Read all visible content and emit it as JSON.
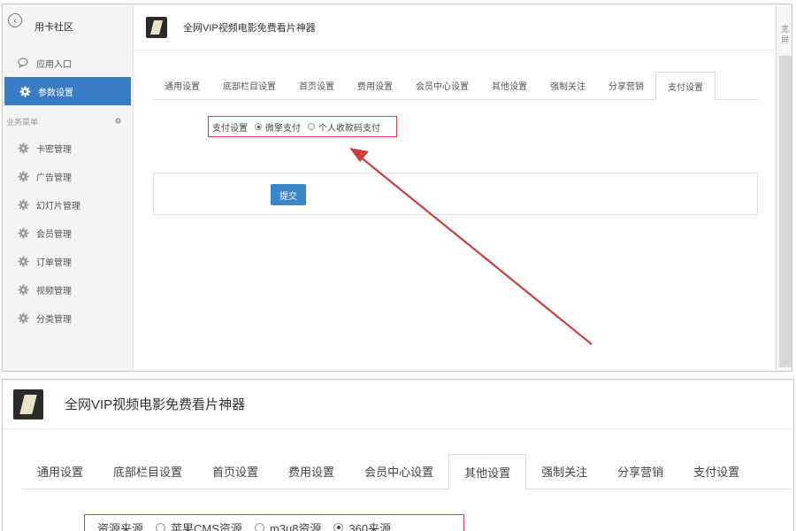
{
  "top": {
    "sidebar": {
      "brand": "用卡社区",
      "items_main": [
        {
          "label": "应用入口",
          "icon": "chat-bubble-icon"
        },
        {
          "label": "参数设置",
          "icon": "gear-icon",
          "active": true
        }
      ],
      "section_label": "业务菜单",
      "items_business": [
        {
          "label": "卡密管理"
        },
        {
          "label": "广告管理"
        },
        {
          "label": "幻灯片管理"
        },
        {
          "label": "会员管理"
        },
        {
          "label": "订单管理"
        },
        {
          "label": "视频管理"
        },
        {
          "label": "分类管理"
        }
      ]
    },
    "header": {
      "title": "全网VIP视频电影免费看片神器"
    },
    "tabs": [
      "通用设置",
      "底部栏目设置",
      "首页设置",
      "费用设置",
      "会员中心设置",
      "其他设置",
      "强制关注",
      "分享营销",
      "支付设置"
    ],
    "active_tab": "支付设置",
    "payment": {
      "label": "支付设置",
      "options": [
        {
          "label": "微擎支付",
          "selected": true
        },
        {
          "label": "个人收款码支付",
          "selected": false
        }
      ]
    },
    "submit_label": "提交",
    "right_strip_label": "宽屏"
  },
  "bottom": {
    "header": {
      "title": "全网VIP视频电影免费看片神器"
    },
    "tabs": [
      "通用设置",
      "底部栏目设置",
      "首页设置",
      "费用设置",
      "会员中心设置",
      "其他设置",
      "强制关注",
      "分享营销",
      "支付设置"
    ],
    "active_tab": "其他设置",
    "source": {
      "label": "资源来源",
      "options": [
        {
          "label": "苹果CMS资源",
          "selected": false
        },
        {
          "label": "m3u8资源",
          "selected": false
        },
        {
          "label": "360来源",
          "selected": true
        }
      ]
    }
  },
  "colors": {
    "accent_blue": "#3a7cc4",
    "button_blue": "#3a86c8",
    "highlight_red": "#c9403f"
  }
}
